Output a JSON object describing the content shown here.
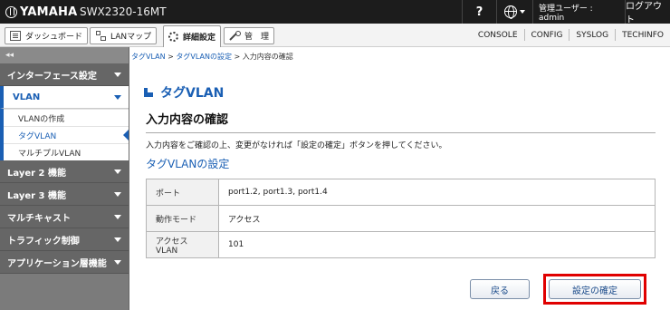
{
  "header": {
    "brand": "YAMAHA",
    "model": "SWX2320-16MT",
    "help": "?",
    "user": "管理ユーザー : admin",
    "logout": "ログアウト"
  },
  "tabs": [
    {
      "label": "ダッシュボード",
      "icon": "dashboard-icon"
    },
    {
      "label": "LANマップ",
      "icon": "lan-map-icon"
    },
    {
      "label": "詳細設定",
      "icon": "gear-icon",
      "active": true
    },
    {
      "label": "管　理",
      "icon": "wrench-icon"
    }
  ],
  "top_links": [
    "CONSOLE",
    "CONFIG",
    "SYSLOG",
    "TECHINFO"
  ],
  "sidebar": {
    "collapse": "◂◂",
    "items": [
      {
        "label": "インターフェース設定"
      },
      {
        "label": "VLAN",
        "open": true
      },
      {
        "label": "Layer 2 機能"
      },
      {
        "label": "Layer 3 機能"
      },
      {
        "label": "マルチキャスト"
      },
      {
        "label": "トラフィック制御"
      },
      {
        "label": "アプリケーション層機能"
      }
    ],
    "vlan_sub": [
      {
        "label": "VLANの作成"
      },
      {
        "label": "タグVLAN",
        "current": true
      },
      {
        "label": "マルチプルVLAN"
      }
    ]
  },
  "main": {
    "breadcrumb": {
      "link1": "タグVLAN",
      "sep1": " > ",
      "link2": "タグVLANの設定",
      "sep2": " > ",
      "current": "入力内容の確認"
    },
    "page_title": "タグVLAN",
    "section_title": "入力内容の確認",
    "description": "入力内容をご確認の上、変更がなければ「設定の確定」ボタンを押してください。",
    "subheading": "タグVLANの設定",
    "rows": [
      {
        "label": "ポート",
        "value": "port1.2, port1.3, port1.4"
      },
      {
        "label": "動作モード",
        "value": "アクセス"
      },
      {
        "label": "アクセスVLAN",
        "value": "101"
      }
    ],
    "back_button": "戻る",
    "confirm_button": "設定の確定"
  },
  "colors": {
    "accent": "#1a5fb4",
    "highlight": "#e00000",
    "sidebar": "#7b7b7b",
    "topbar": "#1c1c1c"
  }
}
